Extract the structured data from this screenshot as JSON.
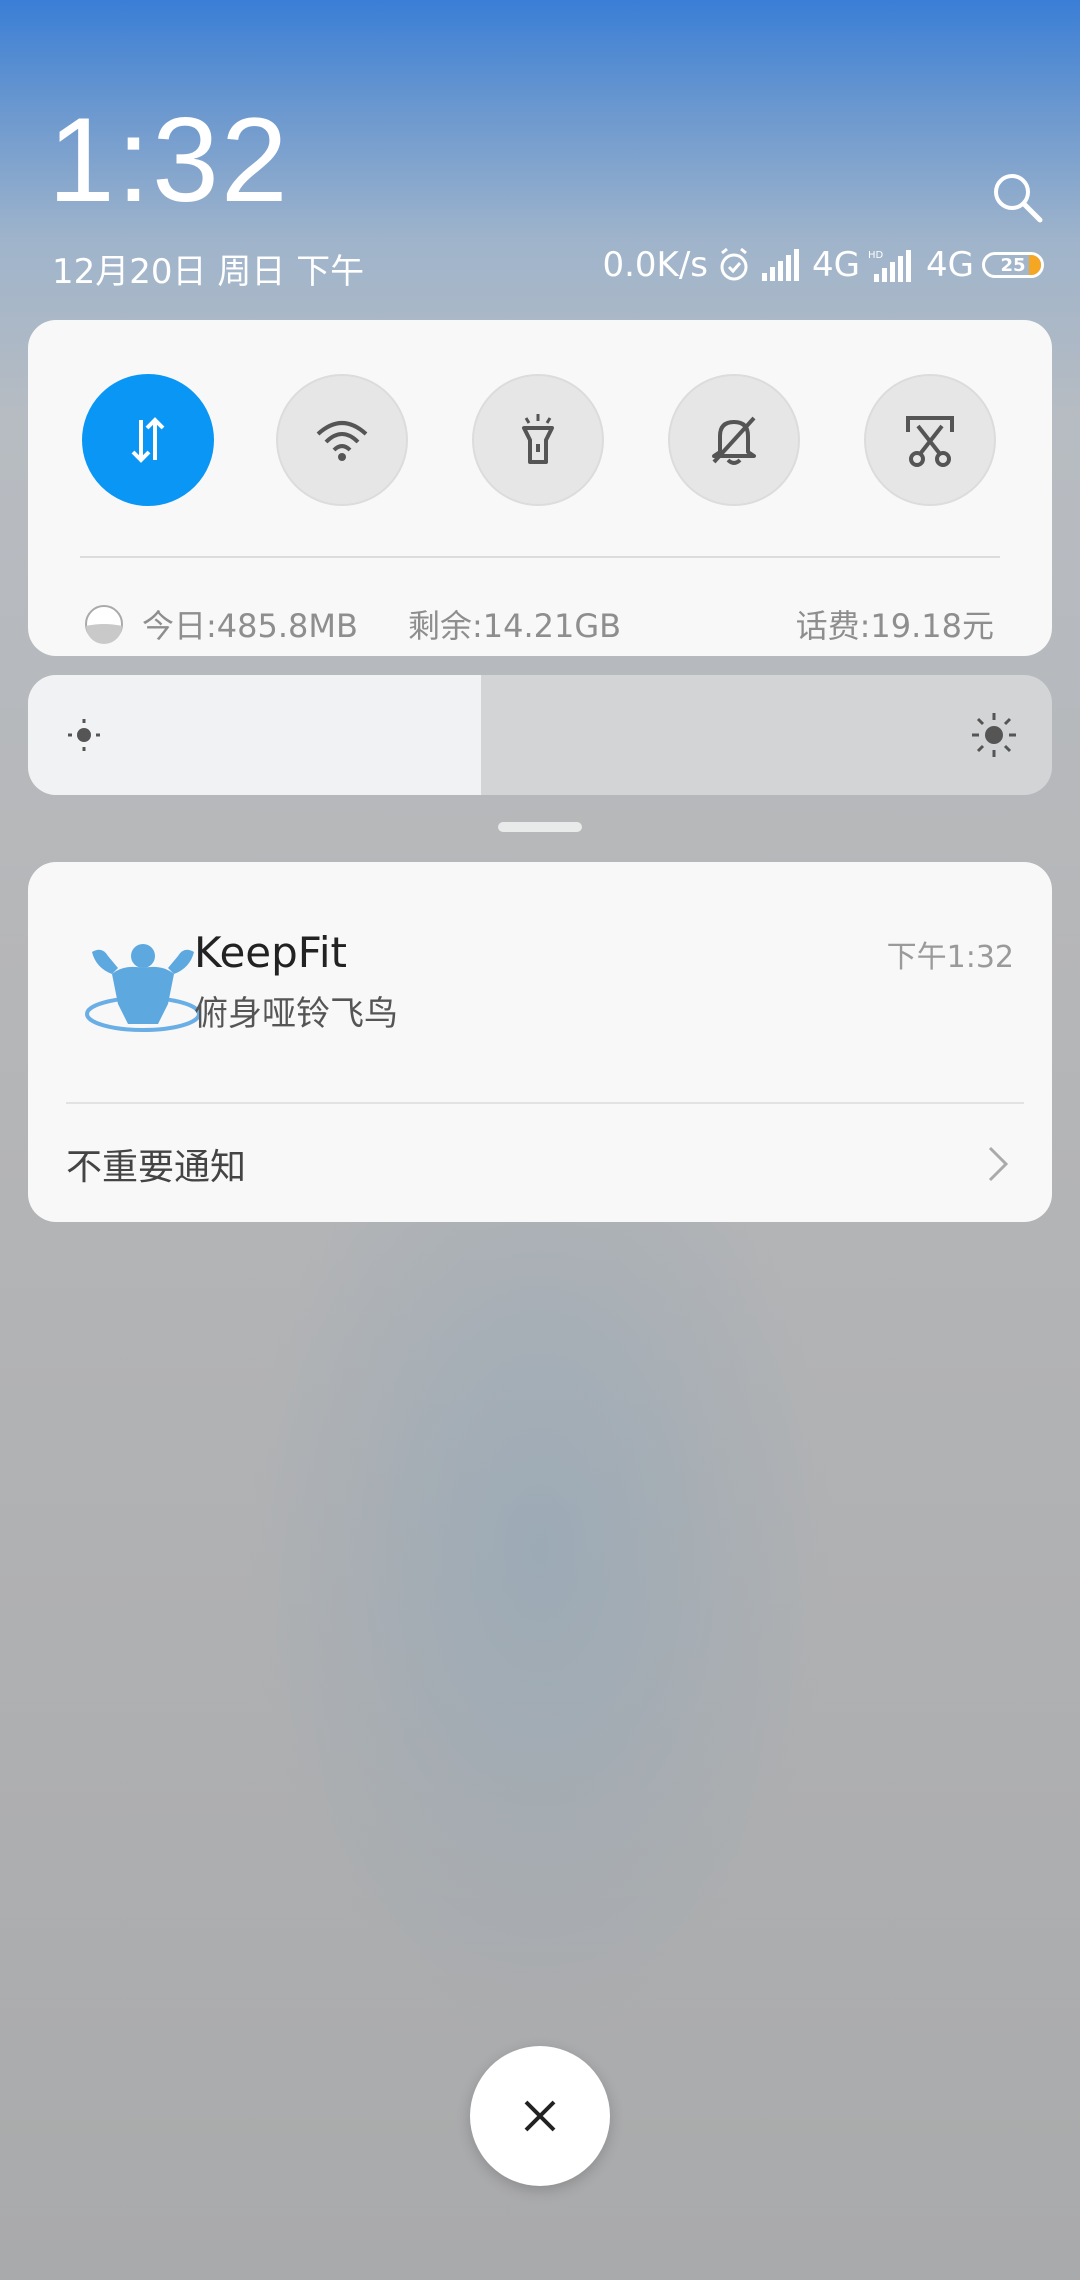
{
  "header": {
    "time": "1:32",
    "date": "12月20日 周日 下午"
  },
  "status_bar": {
    "net_speed": "0.0K/s",
    "sim1_network": "4G",
    "sim2_network": "4G",
    "battery_level": "25",
    "icons": [
      "alarm-icon",
      "signal-icon",
      "signal-icon",
      "battery-icon"
    ]
  },
  "quick_settings": {
    "toggles": [
      {
        "name": "mobile-data",
        "icon": "data-arrows-icon",
        "active": true
      },
      {
        "name": "wifi",
        "icon": "wifi-icon",
        "active": false
      },
      {
        "name": "flashlight",
        "icon": "flashlight-icon",
        "active": false
      },
      {
        "name": "mute",
        "icon": "bell-off-icon",
        "active": false
      },
      {
        "name": "screenshot",
        "icon": "screenshot-scissors-icon",
        "active": false
      }
    ],
    "data_used": "今日:485.8MB",
    "data_remaining": "剩余:14.21GB",
    "balance": "话费:19.18元"
  },
  "brightness": {
    "level_fraction": 0.44
  },
  "notification": {
    "app_name": "KeepFit",
    "text": "俯身哑铃飞鸟",
    "time": "下午1:32",
    "icon": "keepfit-muscle-icon"
  },
  "minor_notifications": {
    "label": "不重要通知"
  },
  "colors": {
    "accent": "#0a96f5",
    "battery_low": "#f5a623"
  }
}
